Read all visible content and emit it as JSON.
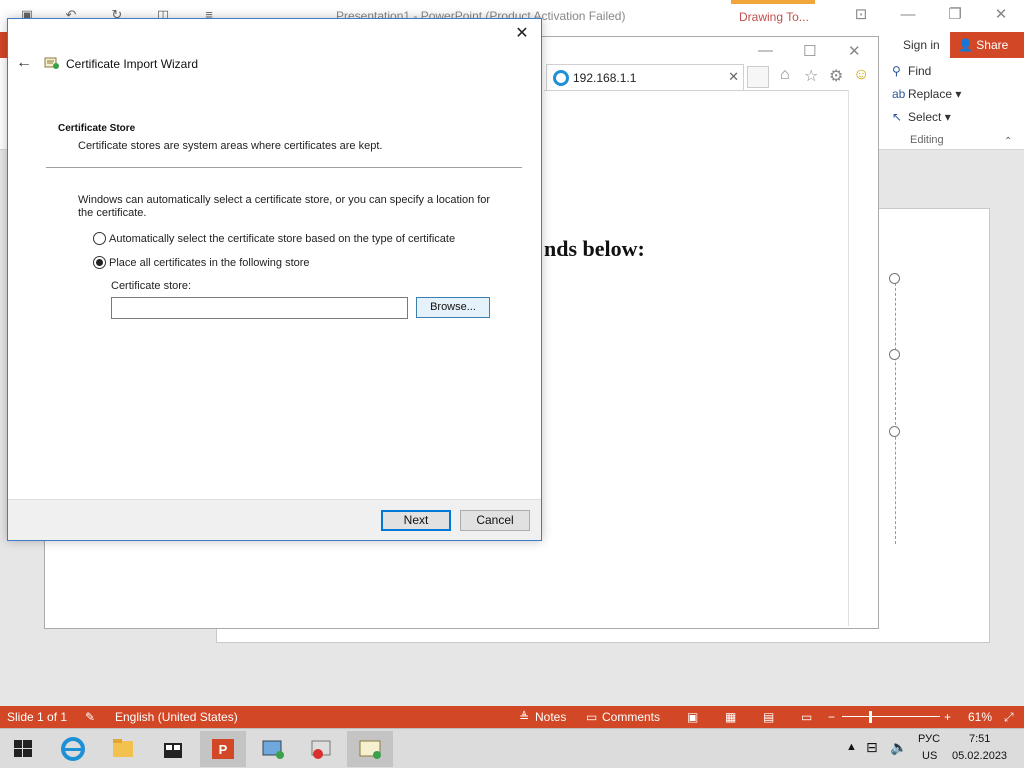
{
  "ppt": {
    "title": "Presentation1 - PowerPoint (Product Activation Failed)",
    "drawing_tab": "Drawing To...",
    "signin": "Sign in",
    "share": "Share",
    "editing": {
      "find": "Find",
      "replace": "Replace",
      "select": "Select",
      "group_label": "Editing"
    }
  },
  "ie": {
    "tab_url": "192.168.1.1",
    "content_heading": "nds below:"
  },
  "wizard": {
    "title": "Certificate Import Wizard",
    "section_title": "Certificate Store",
    "section_desc": "Certificate stores are system areas where certificates are kept.",
    "intro": "Windows can automatically select a certificate store, or you can specify a location for the certificate.",
    "radio_auto": "Automatically select the certificate store based on the type of certificate",
    "radio_place": "Place all certificates in the following store",
    "store_label": "Certificate store:",
    "store_value": "",
    "browse": "Browse...",
    "next": "Next",
    "cancel": "Cancel",
    "selected_option": "place"
  },
  "statusbar": {
    "slide": "Slide 1 of 1",
    "language": "English (United States)",
    "notes": "Notes",
    "comments": "Comments",
    "zoom": "61%"
  },
  "taskbar": {
    "lang_top": "РУС",
    "lang_bottom": "US",
    "time": "7:51",
    "date": "05.02.2023"
  },
  "colors": {
    "accent": "#d24726",
    "dialog_border": "#3a7ec9"
  }
}
